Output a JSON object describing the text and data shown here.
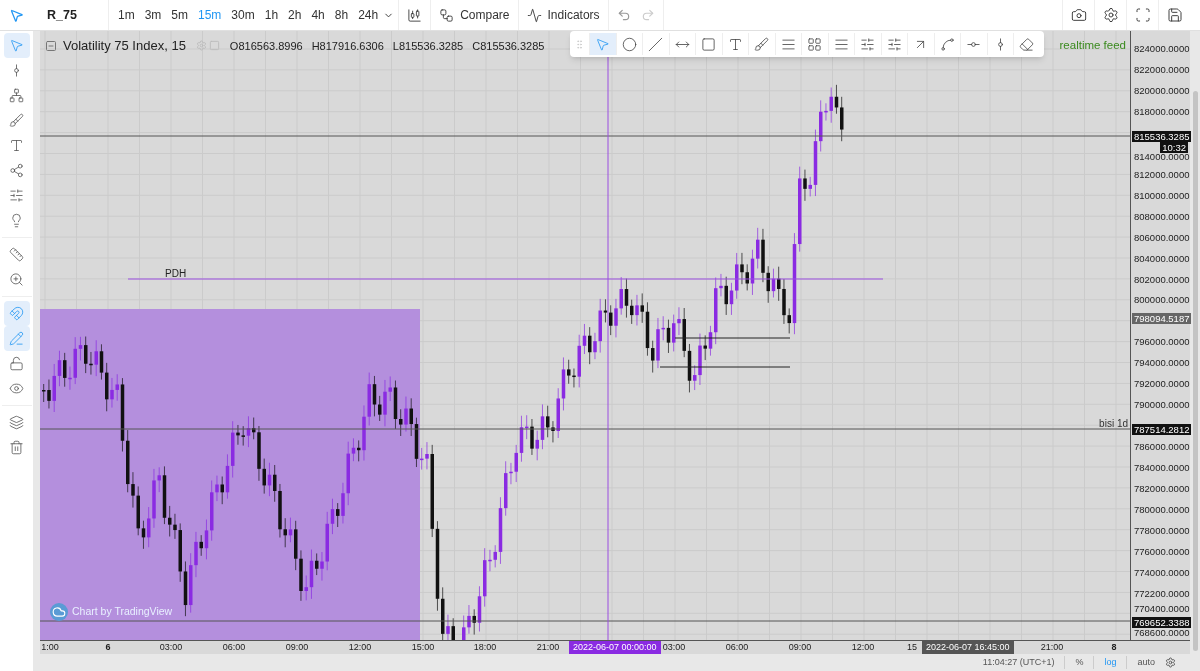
{
  "toolbar": {
    "symbol": "R_75",
    "intervals": [
      {
        "label": "1m",
        "selected": false
      },
      {
        "label": "3m",
        "selected": false
      },
      {
        "label": "5m",
        "selected": false
      },
      {
        "label": "15m",
        "selected": true
      },
      {
        "label": "30m",
        "selected": false
      },
      {
        "label": "1h",
        "selected": false
      },
      {
        "label": "2h",
        "selected": false
      },
      {
        "label": "4h",
        "selected": false
      },
      {
        "label": "8h",
        "selected": false
      },
      {
        "label": "24h",
        "selected": false
      }
    ],
    "compare": "Compare",
    "indicators": "Indicators"
  },
  "left_tools": [
    {
      "kind": "cursor",
      "active": true
    },
    {
      "kind": "crosshair",
      "active": false
    },
    {
      "kind": "fork",
      "active": false
    },
    {
      "kind": "brush",
      "active": false
    },
    {
      "kind": "text",
      "active": false
    },
    {
      "kind": "pattern",
      "active": false
    },
    {
      "kind": "fib",
      "active": false
    },
    {
      "kind": "idea",
      "active": false
    },
    {
      "kind": "ruler",
      "active": false
    },
    {
      "kind": "zoom",
      "active": false
    },
    {
      "kind": "magnet",
      "active": true
    },
    {
      "kind": "lock-drawing",
      "active": true
    },
    {
      "kind": "unlock",
      "active": false
    },
    {
      "kind": "eye",
      "active": false
    },
    {
      "kind": "layers",
      "active": false
    },
    {
      "kind": "trash",
      "active": false
    }
  ],
  "legend": {
    "title": "Volatility 75 Index, 15",
    "values": [
      {
        "label": "O",
        "value": "816563.8996"
      },
      {
        "label": "H",
        "value": "817916.6306"
      },
      {
        "label": "L",
        "value": "815536.3285"
      },
      {
        "label": "C",
        "value": "815536.3285"
      }
    ]
  },
  "drawing_toolbar": [
    {
      "kind": "cursor",
      "selected": true
    },
    {
      "kind": "dot",
      "selected": false
    },
    {
      "kind": "trend",
      "selected": false
    },
    {
      "kind": "hline",
      "selected": false
    },
    {
      "kind": "rect",
      "selected": false
    },
    {
      "kind": "text",
      "selected": false
    },
    {
      "kind": "brush",
      "selected": false
    },
    {
      "kind": "channel",
      "selected": false
    },
    {
      "kind": "grid",
      "selected": false
    },
    {
      "kind": "lines",
      "selected": false
    },
    {
      "kind": "fib",
      "selected": false
    },
    {
      "kind": "fib2",
      "selected": false
    },
    {
      "kind": "arrow",
      "selected": false
    },
    {
      "kind": "path",
      "selected": false
    },
    {
      "kind": "hray",
      "selected": false
    },
    {
      "kind": "vline",
      "selected": false
    },
    {
      "kind": "eraser",
      "selected": false
    }
  ],
  "realtime_label": "realtime feed",
  "chart": {
    "line_labels": [
      "PDH",
      "bisi 1d"
    ],
    "watermark": "Chart by TradingView"
  },
  "price_axis": {
    "labels": [
      "824000.0000",
      "822000.0000",
      "820000.0000",
      "818000.0000",
      "814000.0000",
      "812000.0000",
      "810000.0000",
      "808000.0000",
      "806000.0000",
      "804000.0000",
      "802000.0000",
      "800000.0000",
      "796000.0000",
      "794000.0000",
      "792000.0000",
      "790000.0000",
      "786000.0000",
      "784000.0000",
      "782000.0000",
      "780000.0000",
      "778000.0000",
      "776000.0000",
      "774000.0000",
      "772200.0000",
      "770400.0000",
      "768600.0000"
    ],
    "badges": [
      {
        "text": "815536.3285",
        "kind": "dark"
      },
      {
        "text": "10:32",
        "kind": "dark"
      },
      {
        "text": "798094.5187",
        "kind": "grey"
      },
      {
        "text": "787514.2812",
        "kind": "dark"
      },
      {
        "text": "769652.3388",
        "kind": "dark"
      }
    ]
  },
  "time_axis": {
    "labels": [
      {
        "text": "1:00",
        "bold": false
      },
      {
        "text": "6",
        "bold": true
      },
      {
        "text": "03:00",
        "bold": false
      },
      {
        "text": "06:00",
        "bold": false
      },
      {
        "text": "09:00",
        "bold": false
      },
      {
        "text": "12:00",
        "bold": false
      },
      {
        "text": "15:00",
        "bold": false
      },
      {
        "text": "18:00",
        "bold": false
      },
      {
        "text": "21:00",
        "bold": false
      },
      {
        "text": "03:00",
        "bold": false
      },
      {
        "text": "06:00",
        "bold": false
      },
      {
        "text": "09:00",
        "bold": false
      },
      {
        "text": "12:00",
        "bold": false
      },
      {
        "text": "15",
        "bold": false
      },
      {
        "text": "21:00",
        "bold": false
      },
      {
        "text": "8",
        "bold": true
      }
    ],
    "badges": [
      {
        "text": "2022-06-07 00:00:00",
        "kind": "crosshair"
      },
      {
        "text": "2022-06-07 16:45:00",
        "kind": "dark"
      }
    ]
  },
  "status": {
    "time": "11:04:27 (UTC+1)",
    "options": [
      {
        "label": "%",
        "selected": false
      },
      {
        "label": "log",
        "selected": true
      },
      {
        "label": "auto",
        "selected": false
      }
    ]
  }
}
